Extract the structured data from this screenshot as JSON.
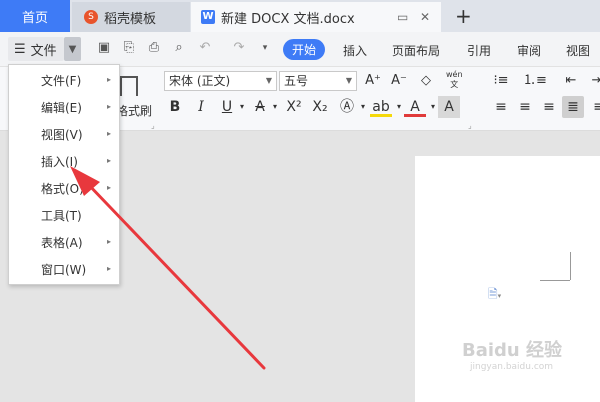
{
  "tabs": {
    "home": "首页",
    "template": "稻壳模板",
    "doc": "新建 DOCX 文档.docx",
    "doc_icon": "W",
    "template_icon": "S",
    "new_tab": "+",
    "restore_icon": "▭",
    "close_icon": "✕"
  },
  "menubar": {
    "file_label": "文件",
    "tabs": [
      "开始",
      "插入",
      "页面布局",
      "引用",
      "审阅",
      "视图"
    ]
  },
  "ribbon": {
    "font_name": "宋体 (正文)",
    "font_size": "五号",
    "format_painter": "格式刷",
    "pinyin": "wén"
  },
  "file_menu": {
    "items": [
      {
        "label": "文件(F)"
      },
      {
        "label": "编辑(E)"
      },
      {
        "label": "视图(V)"
      },
      {
        "label": "插入(I)"
      },
      {
        "label": "格式(O)"
      },
      {
        "label": "工具(T)"
      },
      {
        "label": "表格(A)"
      },
      {
        "label": "窗口(W)"
      }
    ]
  },
  "watermark": {
    "brand": "Baidu 经验",
    "url": "jingyan.baidu.com"
  },
  "colors": {
    "accent": "#3e7bf6",
    "arrow": "#e8383d",
    "highlight": "#f5d90a",
    "font_color_bar": "#e03a3a"
  }
}
